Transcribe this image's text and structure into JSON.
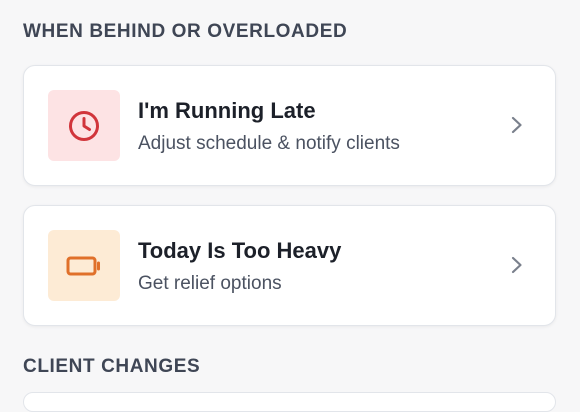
{
  "sections": [
    {
      "title": "WHEN BEHIND OR OVERLOADED",
      "items": [
        {
          "title": "I'm Running Late",
          "subtitle": "Adjust schedule & notify clients",
          "icon": "clock-icon",
          "accent": "#d1353b",
          "icon_bg": "#fde3e4"
        },
        {
          "title": "Today Is Too Heavy",
          "subtitle": "Get relief options",
          "icon": "battery-icon",
          "accent": "#e0702a",
          "icon_bg": "#fdebd5"
        }
      ]
    },
    {
      "title": "CLIENT CHANGES",
      "items": []
    }
  ]
}
